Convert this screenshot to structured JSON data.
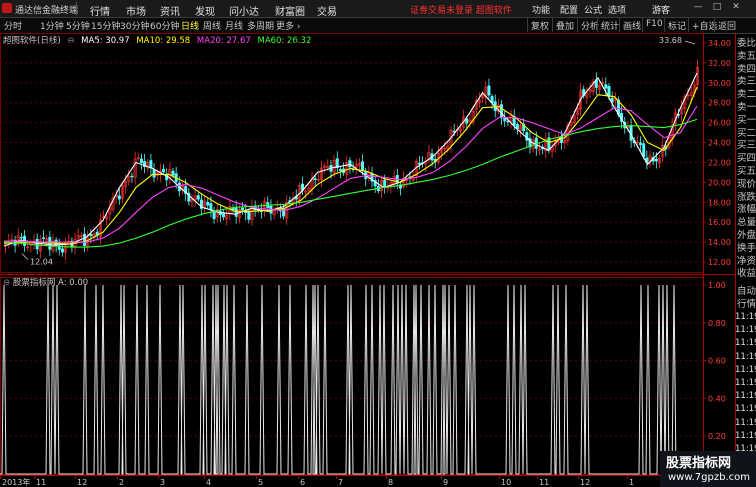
{
  "window": {
    "app_title": "通达信金融终端",
    "menus": [
      "行情",
      "市场",
      "资讯",
      "发现",
      "问小达",
      "财富圈",
      "交易"
    ],
    "alert": "证劵交易未登录",
    "alert_link": "超图软件",
    "right_menus": [
      "功能",
      "配置",
      "公式",
      "选项",
      "游客"
    ],
    "controls": [
      "—",
      "□",
      "✕"
    ]
  },
  "toolbar": {
    "periods": [
      "分时",
      "1分钟",
      "5分钟",
      "15分钟",
      "30分钟",
      "60分钟",
      "日线",
      "周线",
      "月线",
      "多周期",
      "更多"
    ],
    "active_period": "日线",
    "tools": [
      "复权",
      "叠加",
      "分析",
      "统计",
      "画线",
      "F10",
      "标记",
      "+自选",
      "返回"
    ]
  },
  "stock": {
    "name": "超图软件(日线)",
    "ma": [
      {
        "label": "MA5: 30.97",
        "color": "#ffffff"
      },
      {
        "label": "MA10: 29.58",
        "color": "#ffff00"
      },
      {
        "label": "MA20: 27.67",
        "color": "#ff44ff"
      },
      {
        "label": "MA60: 26.32",
        "color": "#33ff33"
      }
    ],
    "high_marker": "33.68",
    "low_marker": "12.04",
    "price_axis": [
      "34.00",
      "32.00",
      "30.00",
      "28.00",
      "26.00",
      "24.00",
      "22.00",
      "20.00",
      "18.00",
      "16.00",
      "14.00",
      "12.00"
    ]
  },
  "indicator": {
    "name": "股票指标网",
    "value": "A: 0.00",
    "axis": [
      "1.00",
      "0.80",
      "0.60",
      "0.40",
      "0.20"
    ]
  },
  "x_axis": [
    "2013年",
    "11",
    "12",
    "2",
    "3",
    "4",
    "5",
    "6",
    "7",
    "8",
    "9",
    "10",
    "11",
    "12",
    "1"
  ],
  "side_panel": {
    "quote_labels": [
      "委比",
      "卖五",
      "卖四",
      "卖三",
      "卖二",
      "卖一",
      "买一",
      "买二",
      "买三",
      "买四",
      "买五",
      "现价",
      "涨跌",
      "涨幅",
      "总量",
      "外盘",
      "换手",
      "净资",
      "收益"
    ],
    "auto_label": "自动",
    "tick_label": "行情",
    "times": [
      "11:19",
      "11:19",
      "11:19",
      "11:19",
      "11:19",
      "11:19",
      "11:19",
      "11:19",
      "11:19",
      "11:19",
      "11:19",
      "11:19"
    ]
  },
  "watermark": {
    "title": "股票指标网",
    "url": "www.7gpzb.com"
  },
  "chart_data": [
    {
      "type": "candlestick",
      "title": "超图软件(日线)",
      "ylim": [
        11,
        35
      ],
      "series": [
        {
          "name": "MA5",
          "color": "#ffffff",
          "values": [
            13.6,
            14.2,
            13.9,
            13.7,
            13.8,
            14.5,
            16.2,
            19.5,
            22.0,
            21.4,
            20.5,
            19.0,
            17.5,
            17.0,
            16.8,
            17.4,
            17.1,
            17.6,
            19.0,
            21.0,
            21.5,
            21.8,
            20.6,
            19.5,
            20.0,
            21.5,
            22.6,
            24.3,
            26.4,
            29.0,
            27.2,
            25.5,
            24.0,
            23.2,
            25.0,
            28.5,
            30.5,
            27.5,
            24.8,
            21.8,
            23.5,
            27.5,
            30.97
          ]
        },
        {
          "name": "MA10",
          "color": "#ffff00",
          "values": [
            13.9,
            14.0,
            14.0,
            13.9,
            13.8,
            14.1,
            15.0,
            17.0,
            19.5,
            20.8,
            20.8,
            20.0,
            18.8,
            17.8,
            17.1,
            17.1,
            17.2,
            17.4,
            18.2,
            19.8,
            20.8,
            21.4,
            21.1,
            20.4,
            20.0,
            20.8,
            21.9,
            23.4,
            25.3,
            27.5,
            27.6,
            26.5,
            25.0,
            24.0,
            24.5,
            26.5,
            28.8,
            28.6,
            26.8,
            24.0,
            23.2,
            25.5,
            29.58
          ]
        },
        {
          "name": "MA20",
          "color": "#ff44ff",
          "values": [
            14.1,
            14.1,
            14.0,
            14.0,
            14.0,
            14.0,
            14.4,
            15.4,
            17.0,
            18.5,
            19.5,
            19.8,
            19.4,
            18.7,
            18.0,
            17.5,
            17.3,
            17.2,
            17.6,
            18.4,
            19.4,
            20.4,
            20.7,
            20.5,
            20.3,
            20.5,
            21.0,
            22.1,
            23.6,
            25.4,
            26.5,
            26.5,
            26.0,
            25.4,
            24.8,
            25.5,
            26.5,
            27.5,
            27.2,
            25.8,
            24.5,
            25.0,
            27.67
          ]
        },
        {
          "name": "MA60",
          "color": "#33ff33",
          "values": [
            14.0,
            13.9,
            13.7,
            13.6,
            13.5,
            13.5,
            13.6,
            13.9,
            14.4,
            15.0,
            15.7,
            16.3,
            16.8,
            17.2,
            17.5,
            17.6,
            17.7,
            17.8,
            18.0,
            18.3,
            18.6,
            18.9,
            19.2,
            19.5,
            19.7,
            20.0,
            20.3,
            20.7,
            21.2,
            21.8,
            22.5,
            23.1,
            23.7,
            24.3,
            24.7,
            25.1,
            25.4,
            25.6,
            25.7,
            25.6,
            25.5,
            25.8,
            26.32
          ]
        }
      ]
    },
    {
      "type": "line",
      "title": "股票指标网",
      "ylim": [
        0,
        1
      ],
      "spikes": [
        4,
        48,
        53,
        57,
        85,
        96,
        103,
        121,
        124,
        137,
        147,
        160,
        180,
        183,
        202,
        205,
        213,
        216,
        218,
        224,
        227,
        234,
        247,
        262,
        279,
        290,
        306,
        313,
        315,
        318,
        325,
        348,
        351,
        366,
        372,
        380,
        384,
        393,
        398,
        402,
        406,
        414,
        416,
        421,
        429,
        435,
        443,
        445,
        449,
        455,
        467,
        470,
        474,
        508,
        514,
        521,
        525,
        553,
        558,
        566,
        583,
        587,
        641,
        648,
        659,
        663,
        667,
        674
      ]
    }
  ]
}
